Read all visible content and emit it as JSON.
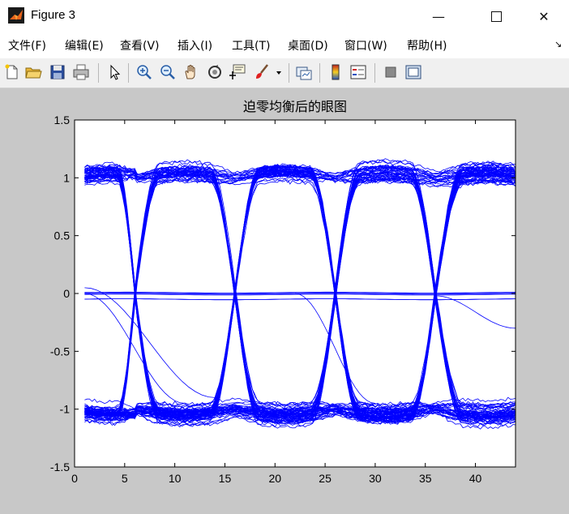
{
  "window": {
    "title": "Figure 3"
  },
  "menu": [
    "文件(F)",
    "编辑(E)",
    "查看(V)",
    "插入(I)",
    "工具(T)",
    "桌面(D)",
    "窗口(W)",
    "帮助(H)"
  ],
  "toolbar_icons": [
    "new-file-icon",
    "open-folder-icon",
    "save-icon",
    "print-icon",
    "pointer-arrow-icon",
    "zoom-in-icon",
    "zoom-out-icon",
    "pan-hand-icon",
    "rotate-3d-icon",
    "data-cursor-icon",
    "brush-icon",
    "brush-dropdown-icon",
    "link-plot-icon",
    "colorbar-icon",
    "legend-icon",
    "hide-plot-tools-icon",
    "show-plot-tools-icon"
  ],
  "chart_data": {
    "type": "line",
    "title": "迫零均衡后的眼图",
    "xlabel": "",
    "ylabel": "",
    "xlim": [
      0,
      44
    ],
    "ylim": [
      -1.5,
      1.5
    ],
    "xticks": [
      0,
      5,
      10,
      15,
      20,
      25,
      30,
      35,
      40
    ],
    "yticks": [
      -1.5,
      -1,
      -0.5,
      0,
      0.5,
      1,
      1.5
    ],
    "xtick_labels": [
      "0",
      "5",
      "10",
      "15",
      "20",
      "25",
      "30",
      "35",
      "40"
    ],
    "ytick_labels": [
      "-1.5",
      "-1",
      "-0.5",
      "0",
      "0.5",
      "1",
      "1.5"
    ],
    "line_color": "#0000ff",
    "grid": false,
    "symbol_period": 10,
    "eye_crossings_x": [
      6,
      16,
      26,
      36
    ],
    "eye_levels": [
      -1,
      1
    ],
    "center_level": 0,
    "trace_x_range": [
      1,
      44
    ]
  }
}
